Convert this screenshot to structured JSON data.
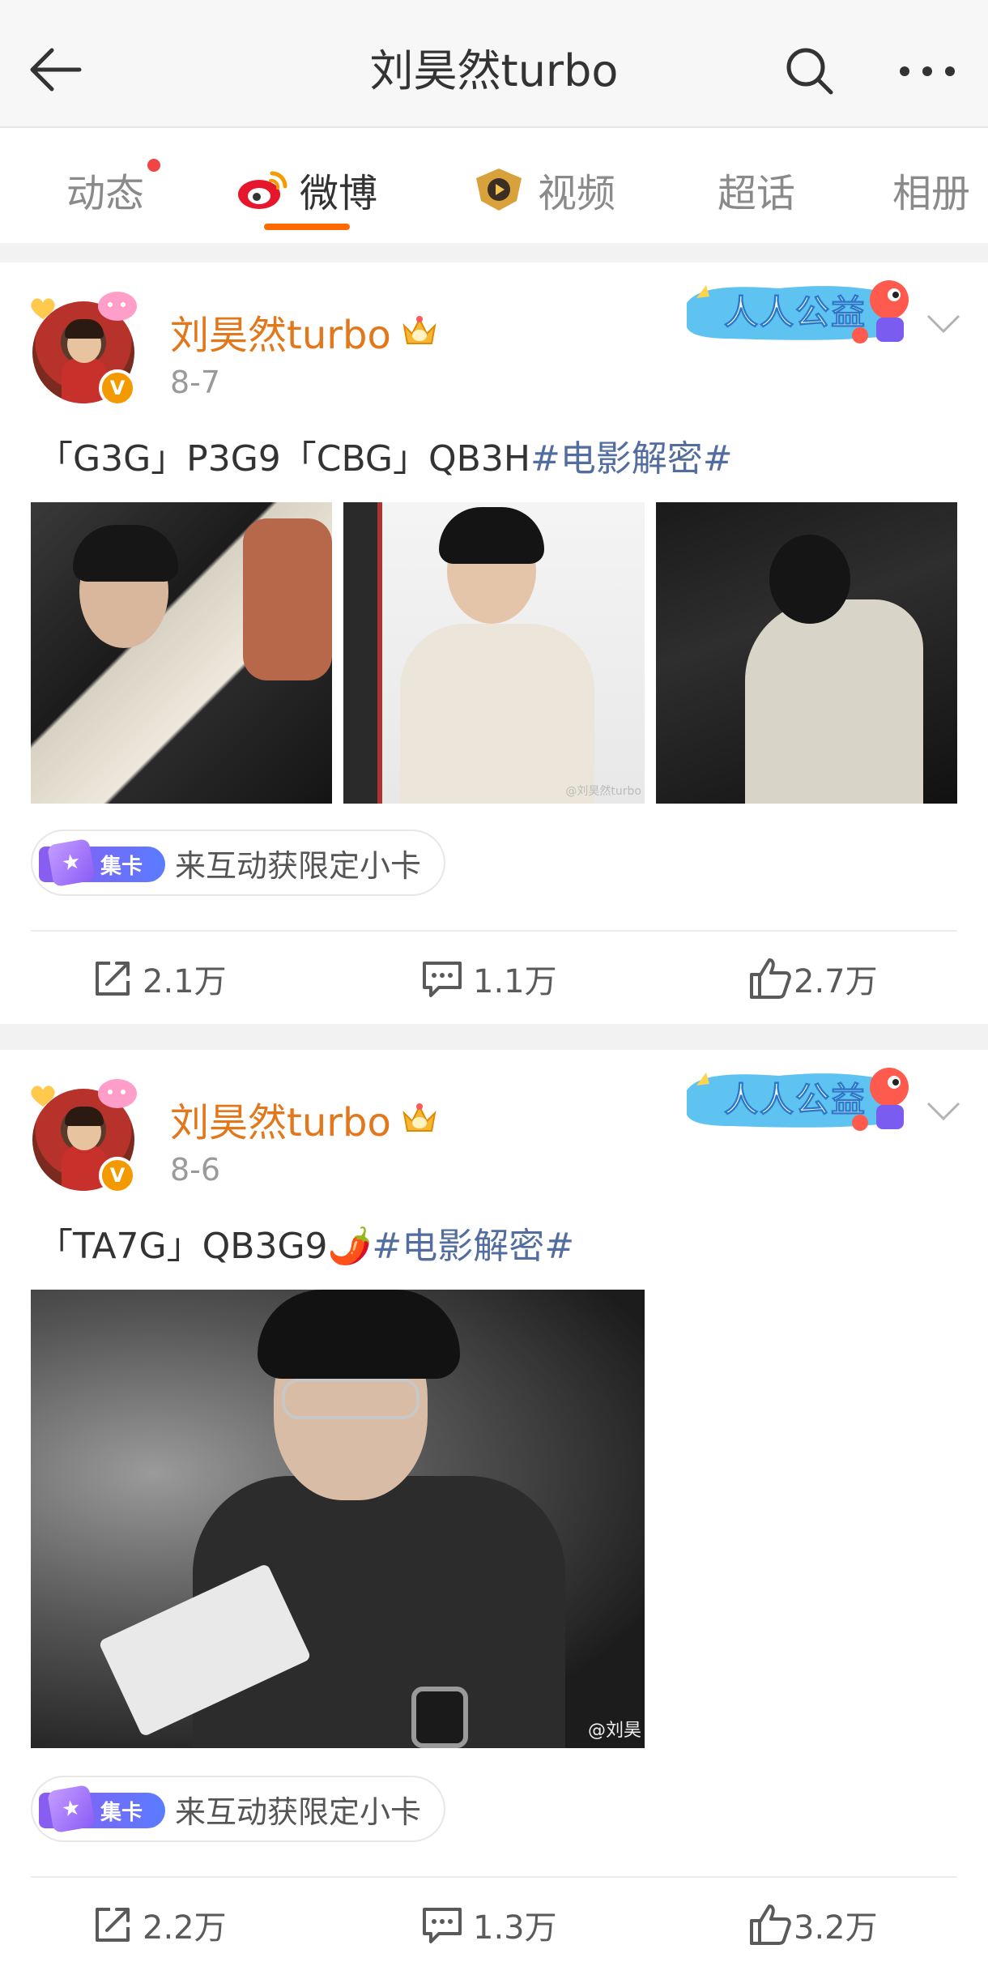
{
  "header": {
    "title": "刘昊然turbo",
    "back_icon": "back-arrow-icon",
    "search_icon": "search-icon",
    "more_icon": "more-icon"
  },
  "tabs": [
    {
      "label": "动态",
      "has_dot": true
    },
    {
      "label": "微博",
      "active": true
    },
    {
      "label": "视频"
    },
    {
      "label": "超话"
    },
    {
      "label": "相册"
    }
  ],
  "colors": {
    "accent": "#ff6a00",
    "username": "#e2771b",
    "hashtag": "#526d9e",
    "verified": "#f39a00"
  },
  "posts": [
    {
      "username": "刘昊然turbo",
      "date": "8-7",
      "badge_text": "人人公益",
      "text": "「G3G」P3G9「CBG」QB3H",
      "hashtag": "#电影解密#",
      "watermark": "@刘昊然turbo",
      "collect_tag": "集卡",
      "collect_text": "来互动获限定小卡",
      "reposts": "2.1万",
      "comments": "1.1万",
      "likes": "2.7万"
    },
    {
      "username": "刘昊然turbo",
      "date": "8-6",
      "badge_text": "人人公益",
      "text": "「TA7G」QB3G9🌶️",
      "hashtag": "#电影解密#",
      "watermark": "@刘昊",
      "collect_tag": "集卡",
      "collect_text": "来互动获限定小卡",
      "reposts": "2.2万",
      "comments": "1.3万",
      "likes": "3.2万"
    }
  ]
}
